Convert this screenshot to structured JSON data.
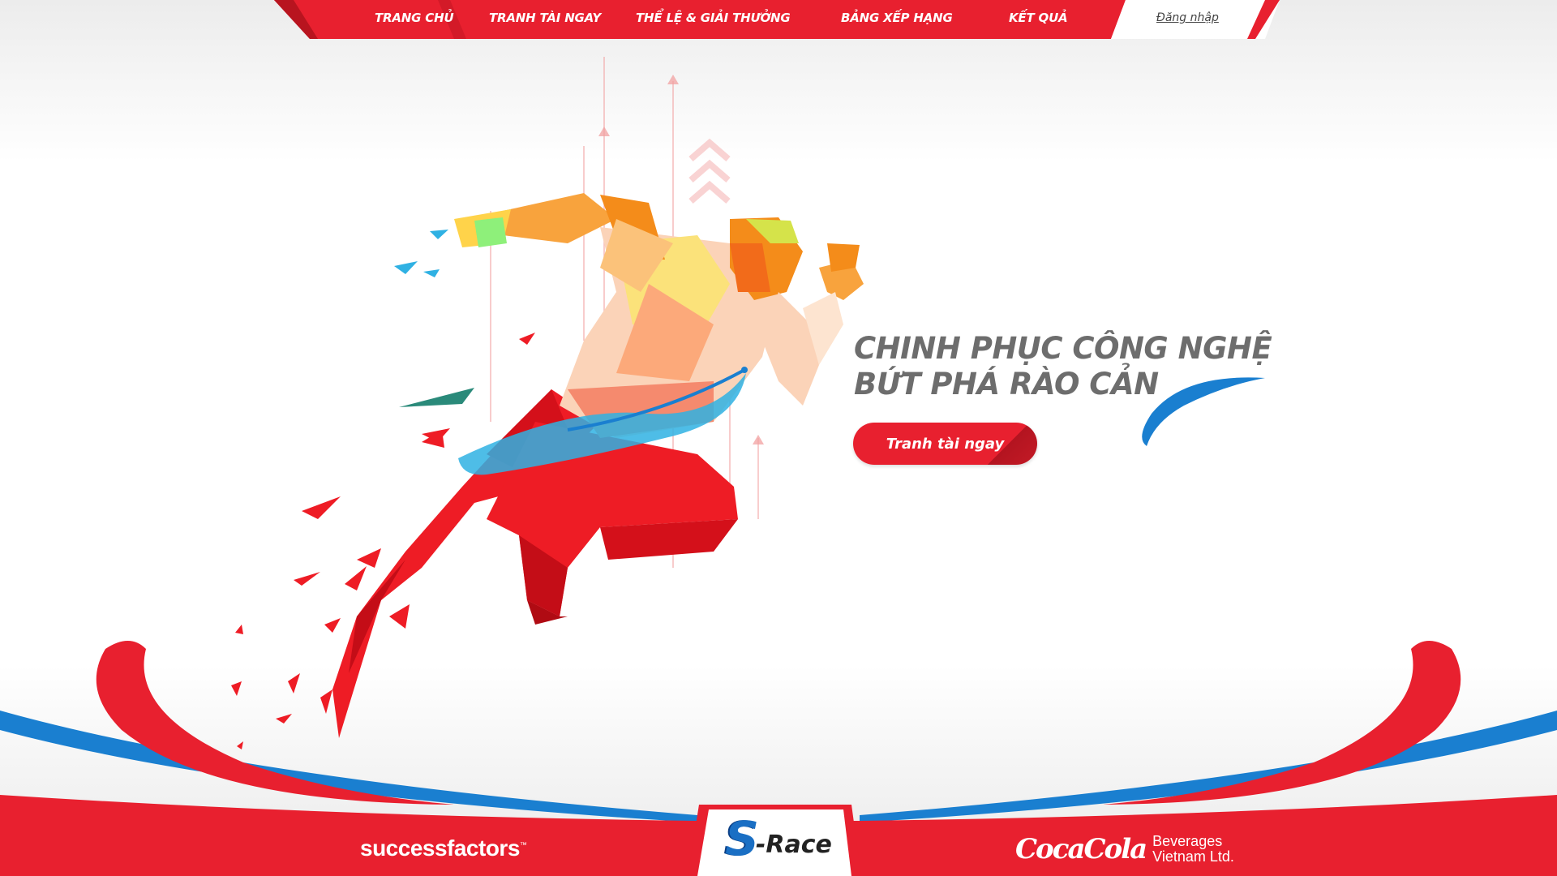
{
  "nav": {
    "items": [
      {
        "label": "TRANG CHỦ"
      },
      {
        "label": "TRANH TÀI NGAY"
      },
      {
        "label": "THỂ LỆ & GIẢI THƯỞNG"
      },
      {
        "label": "BẢNG XẾP HẠNG"
      },
      {
        "label": "KẾT QUẢ"
      }
    ],
    "login_label": "Đăng nhập"
  },
  "hero": {
    "headline_line1": "CHINH PHỤC CÔNG NGHỆ",
    "headline_line2": "BỨT PHÁ RÀO CẢN",
    "cta_label": "Tranh tài ngay"
  },
  "footer": {
    "sponsor_left": "successfactors",
    "sponsor_left_mark": "™",
    "event_logo_s": "S",
    "event_logo_rest": "-Race",
    "sponsor_right_script": "CocaCola",
    "sponsor_right_line1": "Beverages",
    "sponsor_right_line2": "Vietnam Ltd."
  },
  "colors": {
    "brand_red": "#e8202f",
    "brand_blue": "#1a7fd0",
    "headline_gray": "#6d6d6d"
  }
}
